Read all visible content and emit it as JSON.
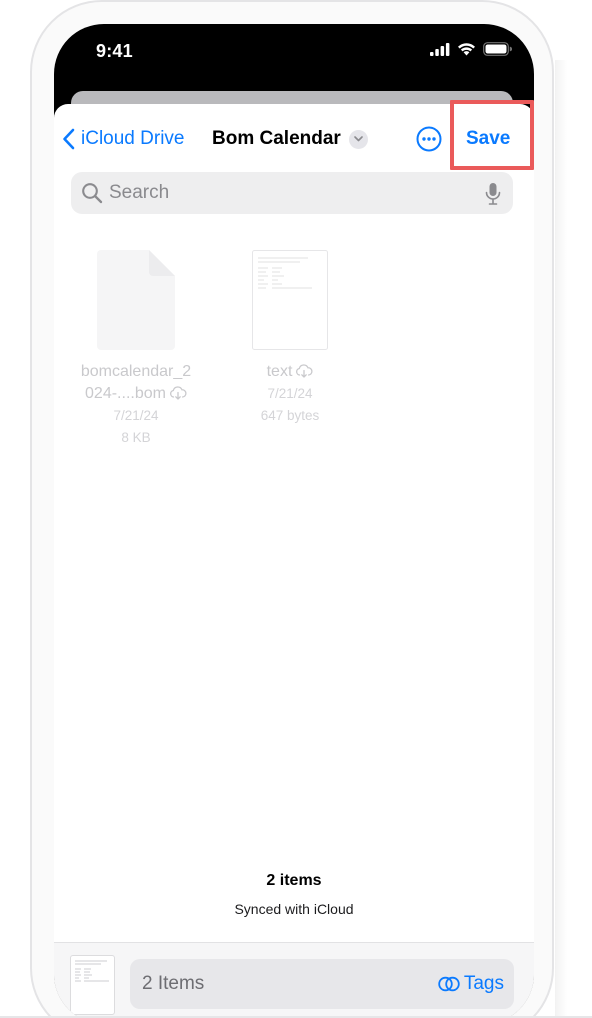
{
  "status_bar": {
    "time": "9:41"
  },
  "nav": {
    "back_label": "iCloud Drive",
    "folder_title": "Bom Calendar",
    "save_label": "Save"
  },
  "search": {
    "placeholder": "Search"
  },
  "files": [
    {
      "name_line1": "bomcalendar_2",
      "name_line2": "024-....bom",
      "date": "7/21/24",
      "size": "8 KB"
    },
    {
      "name_line1": "text",
      "date": "7/21/24",
      "size": "647 bytes"
    }
  ],
  "summary": {
    "count": "2 items",
    "sync_status": "Synced with iCloud"
  },
  "bottom_bar": {
    "items_label": "2 Items",
    "tags_label": "Tags"
  },
  "colors": {
    "accent": "#0a7aff",
    "highlight": "#ea5a5a"
  }
}
